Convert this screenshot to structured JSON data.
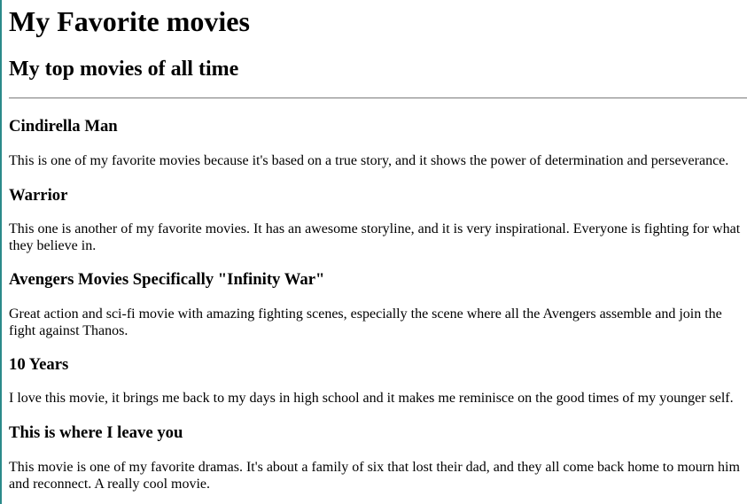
{
  "page": {
    "title": "My Favorite movies",
    "subtitle": "My top movies of all time"
  },
  "movies": [
    {
      "title": "Cindirella Man",
      "description": "This is one of my favorite movies because it's based on a true story, and it shows the power of determination and perseverance."
    },
    {
      "title": "Warrior",
      "description": "This one is another of my favorite movies. It has an awesome storyline, and it is very inspirational. Everyone is fighting for what they believe in."
    },
    {
      "title": "Avengers Movies Specifically \"Infinity War\"",
      "description": "Great action and sci-fi movie with amazing fighting scenes, especially the scene where all the Avengers assemble and join the fight against Thanos."
    },
    {
      "title": "10 Years",
      "description": "I love this movie, it brings me back to my days in high school and it makes me reminisce on the good times of my younger self."
    },
    {
      "title": "This is where I leave you",
      "description": "This movie is one of my favorite dramas. It's about a family of six that lost their dad, and they all come back home to mourn him and reconnect. A really cool movie."
    }
  ]
}
